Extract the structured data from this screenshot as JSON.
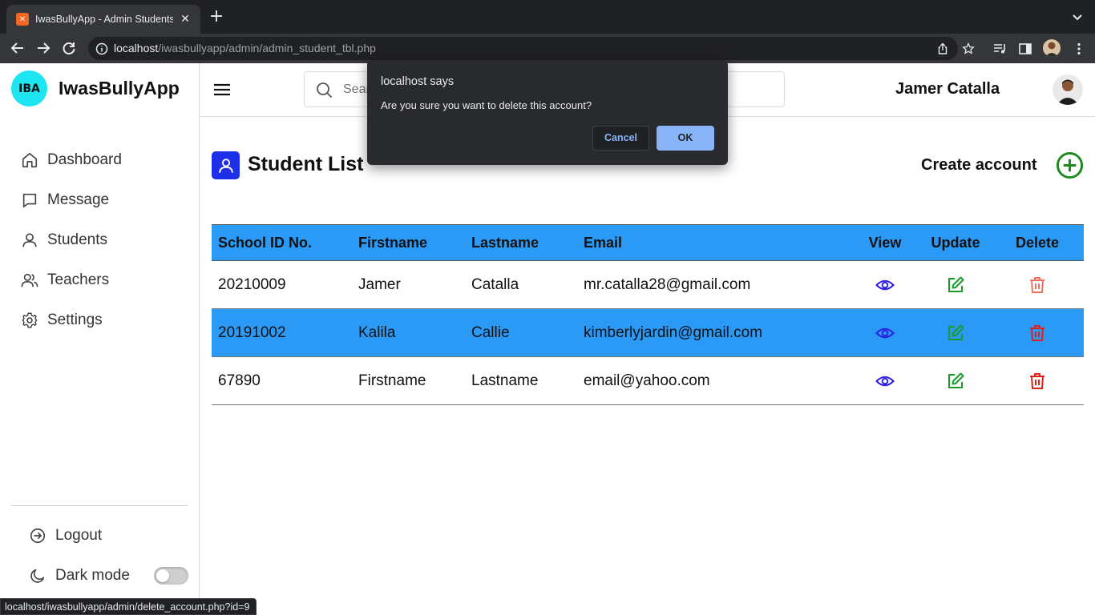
{
  "browser": {
    "tab_title": "IwasBullyApp - Admin Students",
    "url_host": "localhost",
    "url_path": "/iwasbullyapp/admin/admin_student_tbl.php",
    "status_url": "localhost/iwasbullyapp/admin/delete_account.php?id=9"
  },
  "brand": {
    "badge": "IBA",
    "name": "IwasBullyApp",
    "accent": "#1ee6f0"
  },
  "sidebar": {
    "items": [
      {
        "label": "Dashboard",
        "icon": "home-icon"
      },
      {
        "label": "Message",
        "icon": "message-icon"
      },
      {
        "label": "Students",
        "icon": "user-icon"
      },
      {
        "label": "Teachers",
        "icon": "users-icon"
      },
      {
        "label": "Settings",
        "icon": "gear-icon"
      }
    ],
    "logout": "Logout",
    "dark_mode": "Dark mode",
    "dark_mode_on": false
  },
  "header": {
    "search_placeholder": "Search",
    "user_name": "Jamer Catalla"
  },
  "page": {
    "title": "Student List",
    "create_label": "Create account"
  },
  "table": {
    "columns": [
      "School ID No.",
      "Firstname",
      "Lastname",
      "Email",
      "View",
      "Update",
      "Delete"
    ],
    "rows": [
      {
        "id": "20210009",
        "first": "Jamer",
        "last": "Catalla",
        "email": "mr.catalla28@gmail.com"
      },
      {
        "id": "20191002",
        "first": "Kalila",
        "last": "Callie",
        "email": "kimberlyjardin@gmail.com"
      },
      {
        "id": "67890",
        "first": "Firstname",
        "last": "Lastname",
        "email": "email@yahoo.com"
      }
    ],
    "highlight_color": "#2b9af7"
  },
  "dialog": {
    "title": "localhost says",
    "message": "Are you sure you want to delete this account?",
    "cancel": "Cancel",
    "ok": "OK"
  },
  "colors": {
    "view": "#2a1fe0",
    "update": "#1a9a2a",
    "delete": "#e0201a",
    "create": "#1a8a1a"
  }
}
